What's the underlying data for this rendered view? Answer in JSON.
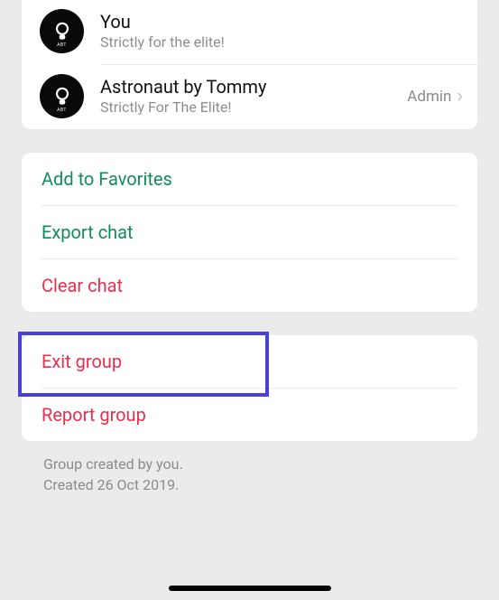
{
  "participants": [
    {
      "name": "You",
      "status": "Strictly for the elite!",
      "role": "",
      "avatar_label": "ABT"
    },
    {
      "name": "Astronaut by Tommy",
      "status": "Strictly For The Elite!",
      "role": "Admin",
      "avatar_label": "ABT"
    }
  ],
  "actions": {
    "favorites": "Add to Favorites",
    "export": "Export chat",
    "clear": "Clear chat"
  },
  "danger": {
    "exit": "Exit group",
    "report": "Report group"
  },
  "meta": {
    "line1": "Group created by you.",
    "line2": "Created 26 Oct 2019."
  }
}
